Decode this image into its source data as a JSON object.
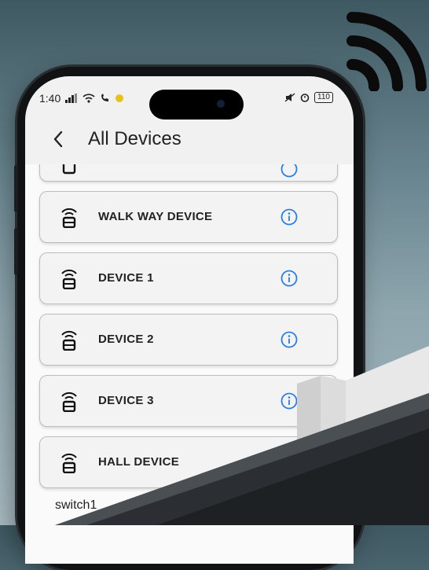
{
  "status_bar": {
    "time": "1:40",
    "signal_icons": "signal-wifi-data-call",
    "battery": "110"
  },
  "app_bar": {
    "back_icon": "chevron-left-icon",
    "title": "All Devices"
  },
  "devices": [
    {
      "label": "WALK WAY DEVICE"
    },
    {
      "label": "DEVICE 1"
    },
    {
      "label": "DEVICE 2"
    },
    {
      "label": "DEVICE 3"
    },
    {
      "label": "HALL DEVICE"
    }
  ],
  "section_label": "switch1",
  "colors": {
    "accent": "#2a7de1",
    "background_top": "#3f5962",
    "background_bottom": "#a8bac1"
  }
}
